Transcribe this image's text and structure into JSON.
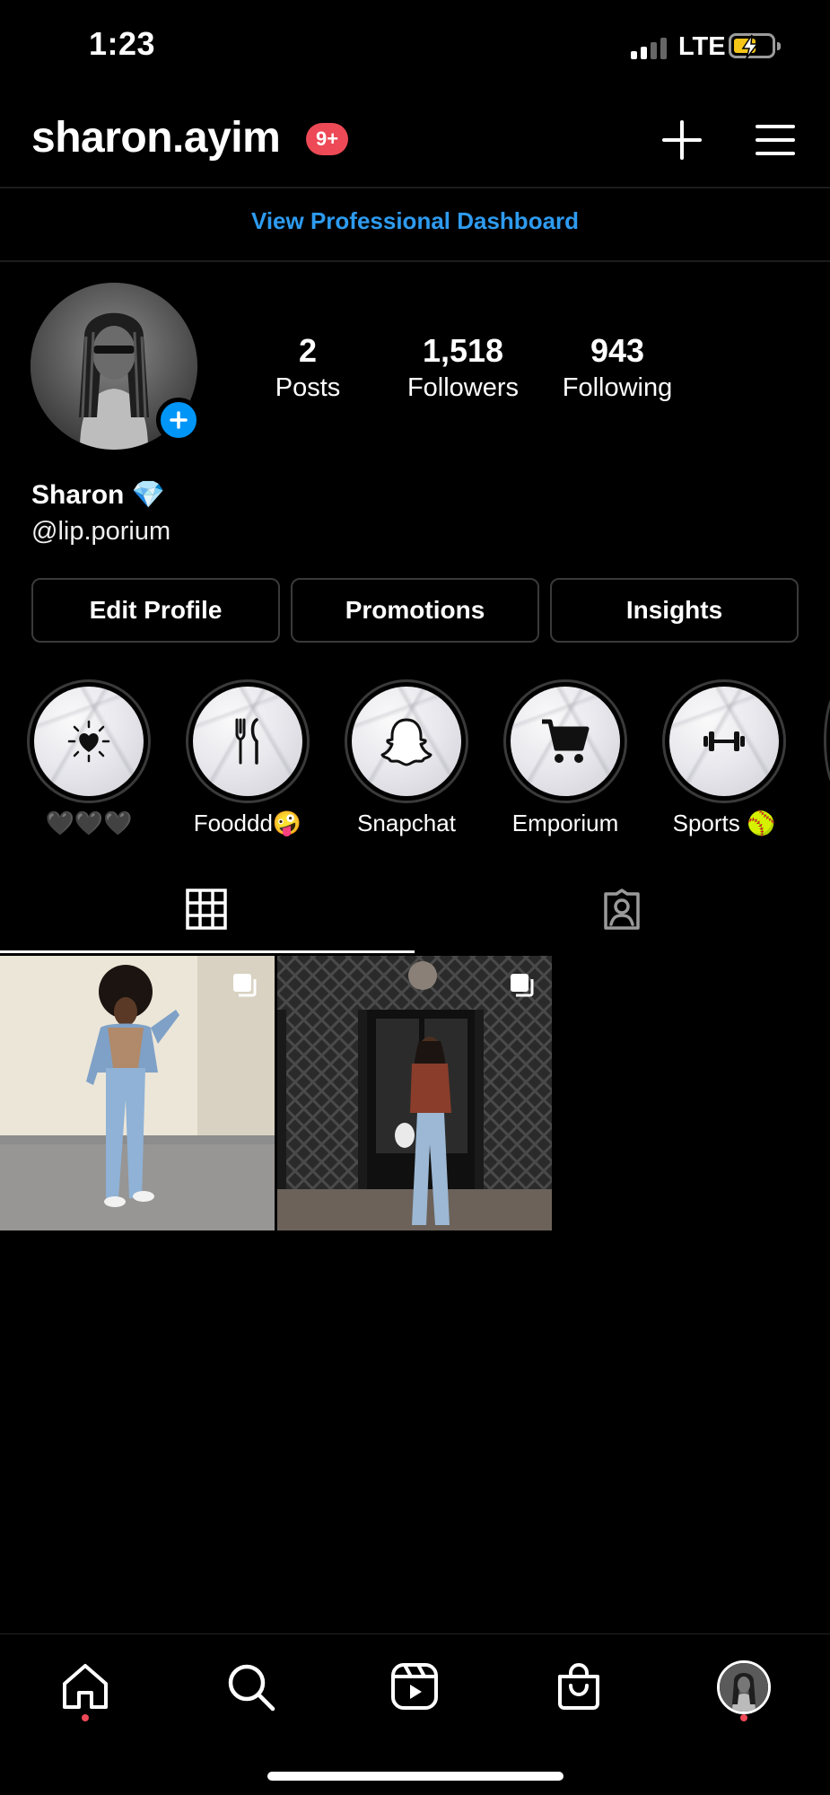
{
  "status_bar": {
    "time": "1:23",
    "network": "LTE"
  },
  "header": {
    "username": "sharon.ayim",
    "notification_badge": "9+",
    "add_icon": "plus-icon",
    "menu_icon": "hamburger-menu-icon"
  },
  "dashboard": {
    "link_text": "View Professional Dashboard"
  },
  "profile": {
    "stats": [
      {
        "value": "2",
        "label": "Posts"
      },
      {
        "value": "1,518",
        "label": "Followers"
      },
      {
        "value": "943",
        "label": "Following"
      }
    ],
    "name": "Sharon 💎",
    "handle": "@lip.porium"
  },
  "actions": {
    "edit_profile": "Edit Profile",
    "promotions": "Promotions",
    "insights": "Insights"
  },
  "highlights": [
    {
      "label": "🖤🖤🖤",
      "icon": "sun-heart-icon"
    },
    {
      "label": "Fooddd🤪",
      "icon": "fork-knife-icon"
    },
    {
      "label": "Snapchat",
      "icon": "ghost-icon"
    },
    {
      "label": "Emporium",
      "icon": "shopping-cart-icon"
    },
    {
      "label": "Sports 🥎",
      "icon": "dumbbell-icon"
    }
  ],
  "tabs": [
    {
      "name": "grid",
      "icon": "grid-icon",
      "active": true
    },
    {
      "name": "tagged",
      "icon": "tagged-person-icon",
      "active": false
    }
  ],
  "posts": [
    {
      "type": "carousel",
      "description": "photo post"
    },
    {
      "type": "carousel",
      "description": "photo post"
    }
  ],
  "bottom_nav": [
    {
      "name": "home",
      "icon": "home-icon",
      "notification_dot": true
    },
    {
      "name": "search",
      "icon": "search-icon",
      "notification_dot": false
    },
    {
      "name": "reels",
      "icon": "reels-icon",
      "notification_dot": false
    },
    {
      "name": "shop",
      "icon": "shopping-bag-icon",
      "notification_dot": false
    },
    {
      "name": "profile",
      "icon": "profile-avatar",
      "notification_dot": true
    }
  ],
  "colors": {
    "background": "#000000",
    "accent_blue": "#2e9bf0",
    "badge_red": "#ed4956",
    "button_border": "#3a3a3a"
  }
}
